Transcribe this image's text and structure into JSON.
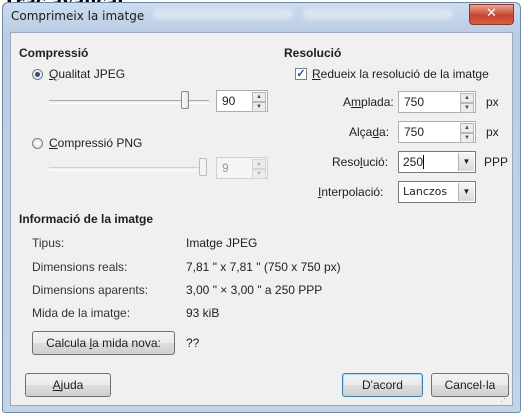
{
  "background_heading": "Trac avançat",
  "window": {
    "title": "Comprimeix la imatge",
    "close_glyph": "✕"
  },
  "compression": {
    "heading": "Compressió",
    "jpeg_label_acc": "Q",
    "jpeg_label_rest": "ualitat JPEG",
    "jpeg_selected": true,
    "jpeg_quality": "90",
    "jpeg_slider_fraction": 0.9,
    "png_label_acc": "C",
    "png_label_rest": "ompressió PNG",
    "png_selected": false,
    "png_level": "9",
    "png_slider_fraction": 1.0
  },
  "resolution": {
    "heading": "Resolució",
    "reduce_acc": "R",
    "reduce_rest": "edueix la resolució de la imatge",
    "reduce_checked": true,
    "check_glyph": "✓",
    "width_pre": "A",
    "width_acc": "m",
    "width_post": "plada:",
    "width_value": "750",
    "width_unit": "px",
    "height_pre": "Alça",
    "height_acc": "d",
    "height_post": "a:",
    "height_value": "750",
    "height_unit": "px",
    "res_pre": "Reso",
    "res_acc": "l",
    "res_post": "ució:",
    "res_value": "250",
    "res_unit": "PPP",
    "interp_acc": "I",
    "interp_post": "nterpolació:",
    "interp_value": "Lanczos"
  },
  "info": {
    "heading": "Informació de la imatge",
    "rows": [
      {
        "label": "Tipus:",
        "value": "Imatge JPEG"
      },
      {
        "label": "Dimensions reals:",
        "value": "7,81 \" x 7,81 \" (750 x 750 px)"
      },
      {
        "label": "Dimensions aparents:",
        "value": "3,00 \" × 3,00 \" a 250 PPP"
      },
      {
        "label": "Mida de la imatge:",
        "value": "93 kiB"
      }
    ],
    "calc_pre": "Calcula ",
    "calc_acc": "l",
    "calc_post": "a mida nova:",
    "calc_result": "??"
  },
  "buttons": {
    "help_acc": "A",
    "help_post": "juda",
    "ok": "D'acord",
    "cancel": "Cancel·la"
  },
  "icons": {
    "spin_up": "▲",
    "spin_down": "▼",
    "dropdown": "▼",
    "grip": "⋰"
  }
}
